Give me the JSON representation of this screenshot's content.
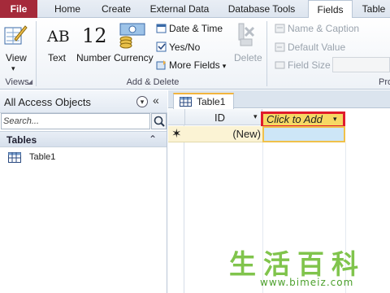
{
  "tabs": [
    {
      "label": "File"
    },
    {
      "label": "Home"
    },
    {
      "label": "Create"
    },
    {
      "label": "External Data"
    },
    {
      "label": "Database Tools"
    },
    {
      "label": "Fields"
    },
    {
      "label": "Table"
    }
  ],
  "ribbon": {
    "views": {
      "view_label": "View",
      "group_label": "Views"
    },
    "add_delete": {
      "text_label": "Text",
      "text_glyph": "AB",
      "number_label": "Number",
      "number_glyph": "12",
      "currency_label": "Currency",
      "date_time_label": "Date & Time",
      "yes_no_label": "Yes/No",
      "more_fields_label": "More Fields",
      "delete_label": "Delete",
      "group_label": "Add & Delete"
    },
    "properties": {
      "name_caption_label": "Name & Caption",
      "default_value_label": "Default Value",
      "field_size_label": "Field Size",
      "group_label_partial": "Pro"
    }
  },
  "nav": {
    "title": "All Access Objects",
    "search_placeholder": "Search...",
    "section_label": "Tables",
    "items": [
      {
        "label": "Table1"
      }
    ]
  },
  "document": {
    "tab_label": "Table1",
    "columns": [
      {
        "label": "ID"
      }
    ],
    "click_to_add": "Click to Add",
    "new_row_value": "(New)",
    "new_row_marker": "✶"
  },
  "watermark": {
    "chars": "生活百科",
    "url": "www.bimeiz.com"
  },
  "colors": {
    "file_tab": "#a52a3a",
    "highlight_border": "#e01b2c",
    "click_add_fill": "#f6d864",
    "watermark": "#7ac143"
  }
}
